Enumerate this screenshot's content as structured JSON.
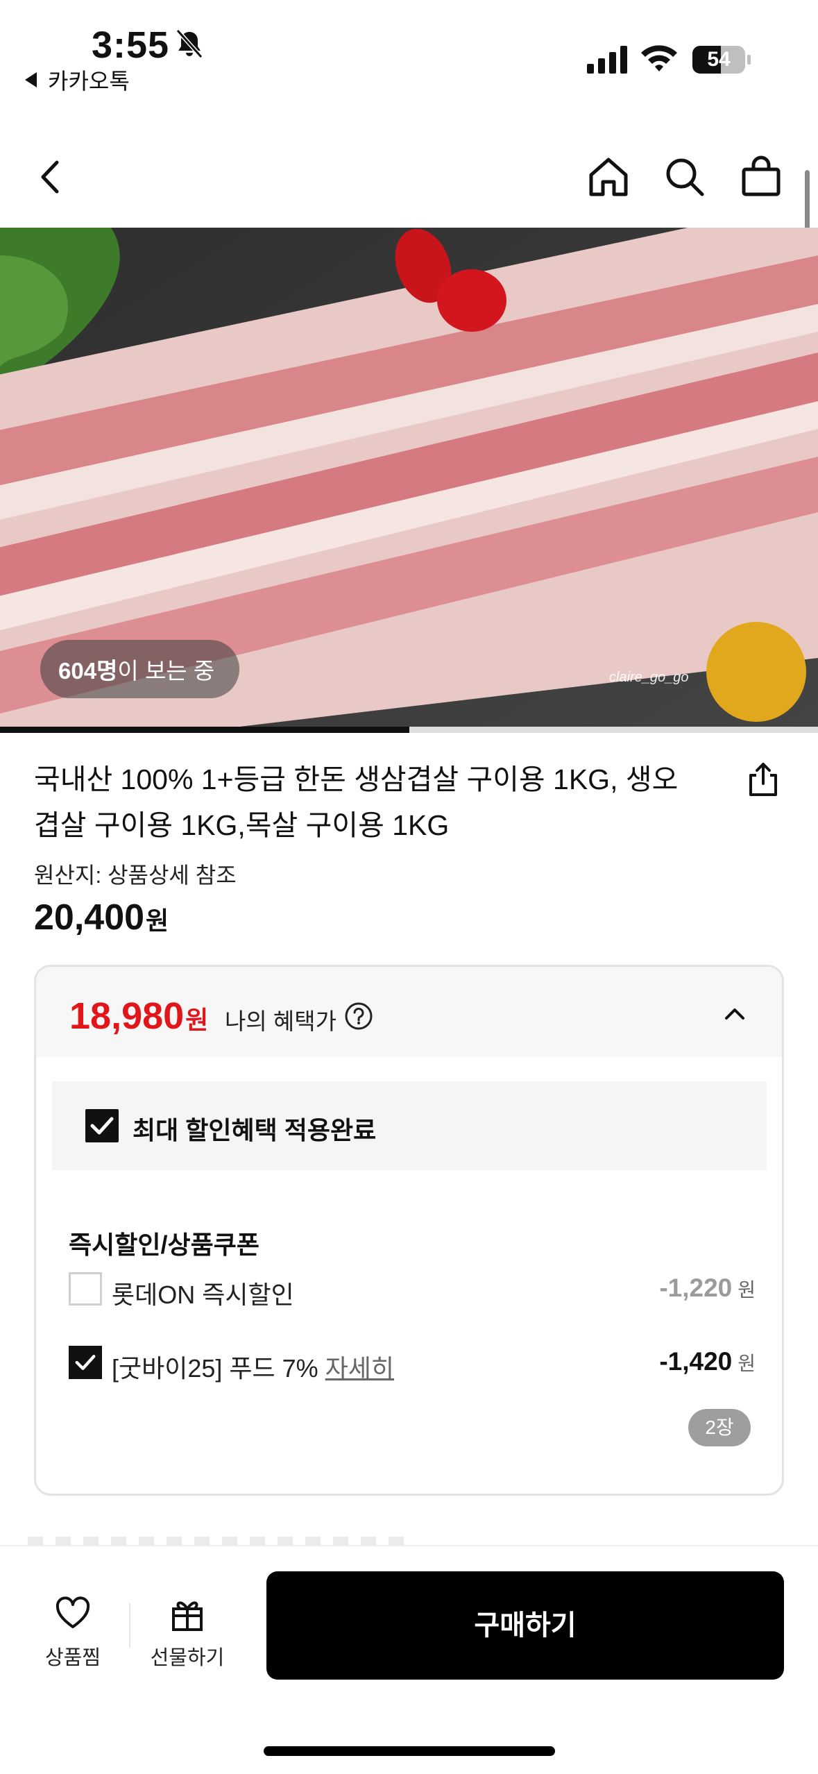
{
  "status_bar": {
    "time": "3:55",
    "back_app": "카카오톡",
    "battery_level": "54"
  },
  "nav": {
    "icons": [
      "back-icon",
      "home-icon",
      "search-icon",
      "cart-icon"
    ]
  },
  "hero": {
    "viewers_count": "604명",
    "viewers_suffix": "이 보는 중",
    "watermark": "claire_go_go",
    "gallery_progress": 0.5
  },
  "product": {
    "title": "국내산 100% 1+등급 한돈 생삼겹살 구이용 1KG, 생오겹살 구이용 1KG,목살 구이용 1KG",
    "origin": "원산지: 상품상세 참조",
    "price": "20,400",
    "price_unit": "원"
  },
  "benefit": {
    "my_price": "18,980",
    "my_price_unit": "원",
    "my_price_label": "나의 혜택가",
    "max_applied": "최대 할인혜택 적용완료",
    "section_title": "즉시할인/상품쿠폰",
    "items": [
      {
        "label": "롯데ON 즉시할인",
        "more": "",
        "amount": "-1,220",
        "unit": "원",
        "checked": false
      },
      {
        "label": "[굿바이25] 푸드 7%",
        "more": "자세히",
        "amount": "-1,420",
        "unit": "원",
        "checked": true
      }
    ],
    "coupon_count": "2장"
  },
  "bottom_bar": {
    "wish_label": "상품찜",
    "gift_label": "선물하기",
    "buy_label": "구매하기"
  },
  "colors": {
    "accent_red": "#e0161b",
    "primary_black": "#000000",
    "muted_gray": "#9b9b9b"
  }
}
